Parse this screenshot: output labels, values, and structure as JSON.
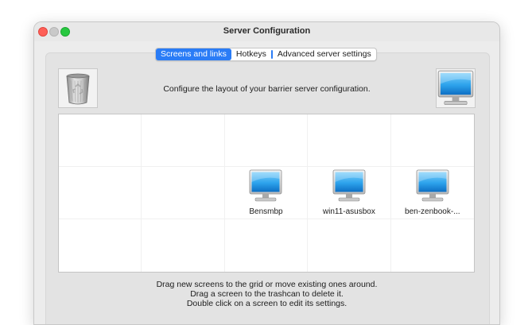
{
  "window": {
    "title": "Server Configuration"
  },
  "tabs": [
    {
      "label": "Screens and links",
      "active": true
    },
    {
      "label": "Hotkeys",
      "active": false
    },
    {
      "label": "Advanced server settings",
      "active": false
    }
  ],
  "main": {
    "configure_message": "Configure the layout of your barrier server configuration.",
    "trash_icon": "trash-can-icon",
    "new_screen_icon": "monitor-icon"
  },
  "grid": {
    "rows": 3,
    "columns": 5,
    "screens": [
      {
        "name": "Bensmbp",
        "row": 1,
        "col": 2
      },
      {
        "name": "win11-asusbox",
        "row": 1,
        "col": 3
      },
      {
        "name": "ben-zenbook-...",
        "row": 1,
        "col": 4
      }
    ]
  },
  "help": {
    "line1": "Drag new screens to the grid or move existing ones around.",
    "line2": "Drag a screen to the trashcan to delete it.",
    "line3": "Double click on a screen to edit its settings."
  },
  "colors": {
    "accent": "#2a7cf6",
    "close": "#fe5f57",
    "maximize": "#28c840",
    "monitor_screen": "#1e8fd9"
  }
}
